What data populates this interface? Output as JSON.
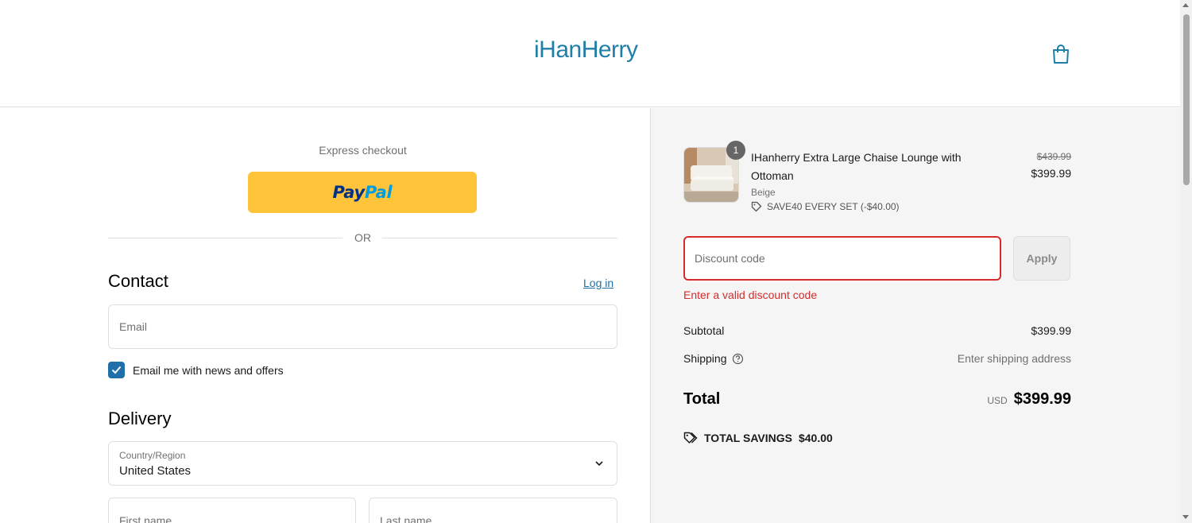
{
  "header": {
    "logo_text": "iHanHerry",
    "cart_icon": "shopping-bag-icon"
  },
  "express": {
    "label": "Express checkout",
    "paypal_part1": "Pay",
    "paypal_part2": "Pal",
    "or_label": "OR"
  },
  "contact": {
    "title": "Contact",
    "login_label": "Log in",
    "email_placeholder": "Email",
    "newsletter_label": "Email me with news and offers",
    "newsletter_checked": true
  },
  "delivery": {
    "title": "Delivery",
    "country_label": "Country/Region",
    "country_value": "United States",
    "first_name_placeholder": "First name",
    "last_name_placeholder": "Last name"
  },
  "summary": {
    "product": {
      "quantity": "1",
      "title": "IHanherry Extra Large Chaise Lounge with Ottoman",
      "variant": "Beige",
      "discount": "SAVE40 EVERY SET (-$40.00)",
      "original_price": "$439.99",
      "price": "$399.99"
    },
    "discount_placeholder": "Discount code",
    "apply_label": "Apply",
    "error_message": "Enter a valid discount code",
    "subtotal_label": "Subtotal",
    "subtotal_value": "$399.99",
    "shipping_label": "Shipping",
    "shipping_value": "Enter shipping address",
    "total_label": "Total",
    "total_currency": "USD",
    "total_value": "$399.99",
    "savings_label": "TOTAL SAVINGS",
    "savings_value": "$40.00"
  },
  "colors": {
    "brand": "#1f7fa8",
    "paypal_yellow": "#ffc439",
    "error": "#d72c2c",
    "link": "#1f6fa8"
  }
}
